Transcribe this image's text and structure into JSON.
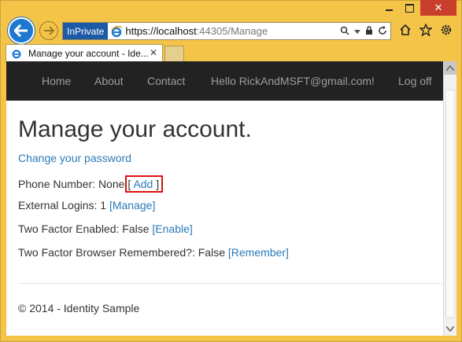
{
  "window": {
    "minimize_icon": "minimize-icon",
    "maximize_icon": "maximize-icon",
    "close_icon": "close-icon",
    "close_glyph": "✕"
  },
  "browser": {
    "inprivate_label": "InPrivate",
    "url_prefix": "https://localhost",
    "url_port": ":44305",
    "url_path": "/Manage",
    "tab_title": "Manage your account - Ide...",
    "tab_close": "✕",
    "accent": "#1e78d2"
  },
  "navbar": {
    "items": [
      {
        "label": "Home"
      },
      {
        "label": "About"
      },
      {
        "label": "Contact"
      },
      {
        "label": "Hello RickAndMSFT@gmail.com!"
      },
      {
        "label": "Log off"
      }
    ]
  },
  "main": {
    "title": "Manage your account.",
    "change_password": "Change your password",
    "phone": {
      "label": "Phone Number: None",
      "open": "[",
      "link": "Add",
      "close": "]"
    },
    "external_logins": {
      "label": "External Logins: 1",
      "link": "[Manage]"
    },
    "two_factor": {
      "label": "Two Factor Enabled: False",
      "link": "[Enable]"
    },
    "browser_remembered": {
      "label": "Two Factor Browser Remembered?: False",
      "link": "[Remember]"
    }
  },
  "footer": {
    "text": "© 2014 - Identity Sample"
  },
  "colors": {
    "link": "#2a7ab8",
    "highlight": "#dd1111",
    "navbar": "#222222"
  }
}
